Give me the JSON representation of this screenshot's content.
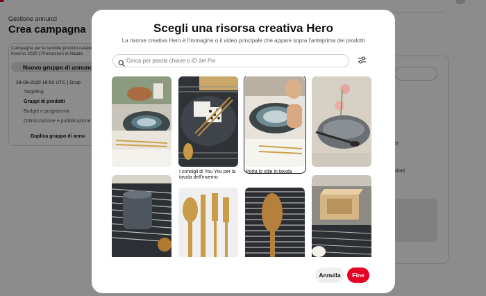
{
  "background": {
    "breadcrumb": "Gestione annunci",
    "page_title": "Crea campagna",
    "campaign_desc_line1": "Campagna per le vendite prodotti catalogo",
    "campaign_desc_line2": "Inverno 2020 | Promozioni di Natale",
    "new_group_label": "Nuovo gruppo di annunci",
    "group_date": "24-09-2020 16:53 UTC | Grup",
    "nav_items": [
      {
        "label": "Targeting"
      },
      {
        "label": "Gruppi di prodotti"
      },
      {
        "label": "Budget e programma"
      },
      {
        "label": "Ottimizzazione e pubblicazione"
      }
    ],
    "duplicate_label": "Duplica gruppo di annu",
    "right_text_1": "tto",
    "right_text_2": "odotti"
  },
  "modal": {
    "title": "Scegli una risorsa creativa Hero",
    "subtitle": "La risorse creativa Hero è l'immagine o il video principale che appare sopra l'anteprima dei prodotti",
    "search_placeholder": "Cerca per parola chiave o ID del Pin",
    "pins": [
      {
        "caption": ""
      },
      {
        "caption": "I consigli di You You per la tavola dell'inverno"
      },
      {
        "caption": "Porta lo stile in tavola"
      },
      {
        "caption": ""
      },
      {
        "caption": ""
      },
      {
        "caption": ""
      },
      {
        "caption": ""
      },
      {
        "caption": ""
      }
    ],
    "selected_pin_index": 2,
    "cancel_label": "Annulla",
    "done_label": "Fine"
  },
  "colors": {
    "brand_red": "#e60023",
    "overlay": "rgba(0,0,0,0.45)"
  },
  "icons": {
    "search": "search-icon",
    "filter": "filter-icon"
  }
}
